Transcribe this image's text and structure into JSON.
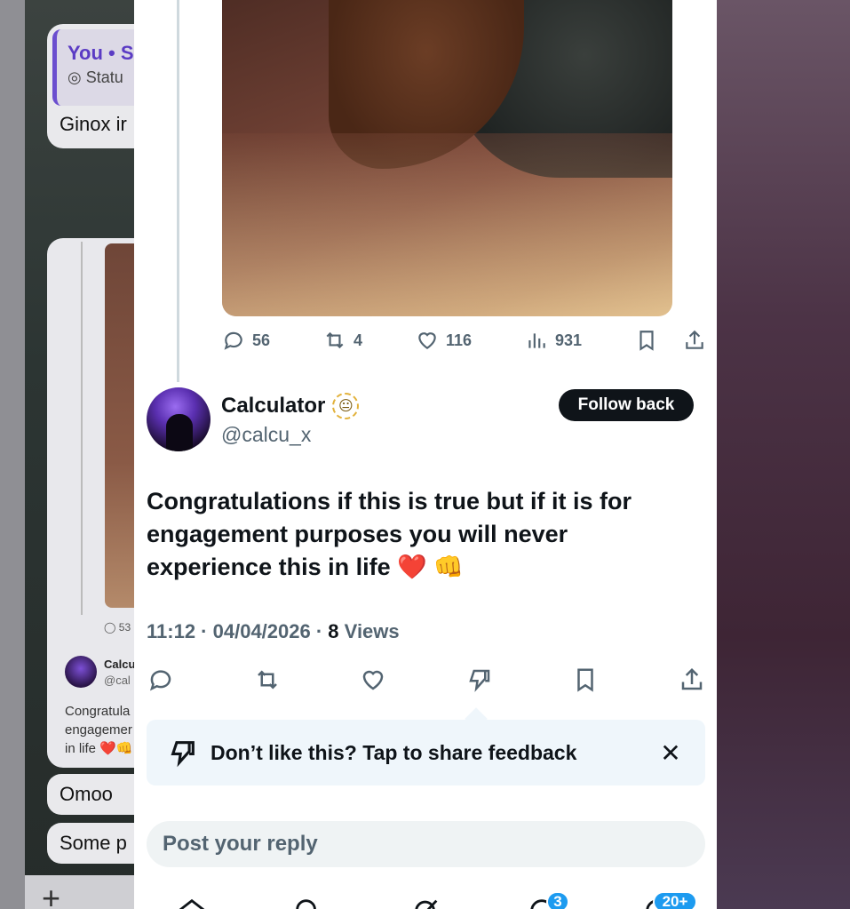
{
  "background": {
    "quoted_title": "You • S",
    "quoted_subtitle": "Statu",
    "quoted_text": "Ginox ir",
    "mini_stat": "53",
    "mini_name": "Calcu",
    "mini_handle": "@cal",
    "mini_text": "Congratula\nengagemer\nin life ❤️👊",
    "bubble_1": "Omoo",
    "bubble_2": "Some p"
  },
  "post_stats": {
    "replies": "56",
    "reposts": "4",
    "likes": "116",
    "views": "931"
  },
  "reply": {
    "author_name": "Calculator",
    "author_badge": "😐",
    "author_handle": "@calcu_x",
    "follow_label": "Follow back",
    "text": "Congratulations if this is true but if it is for engagement purposes you will never experience this in life",
    "emoji_heart": "❤️",
    "emoji_fist": "👊",
    "time": "11:12",
    "date": "04/04/2026",
    "views_count": "8",
    "views_label": "Views"
  },
  "feedback": {
    "text": "Don’t like this? Tap to share feedback",
    "close_label": "✕"
  },
  "composer": {
    "placeholder": "Post your reply"
  },
  "tabbar": {
    "messages_badge": "3",
    "notifications_badge": "20+"
  },
  "colors": {
    "text_primary": "#0f1419",
    "text_secondary": "#536471",
    "accent": "#1d9bf0",
    "feedback_bg": "#eff6fb"
  }
}
